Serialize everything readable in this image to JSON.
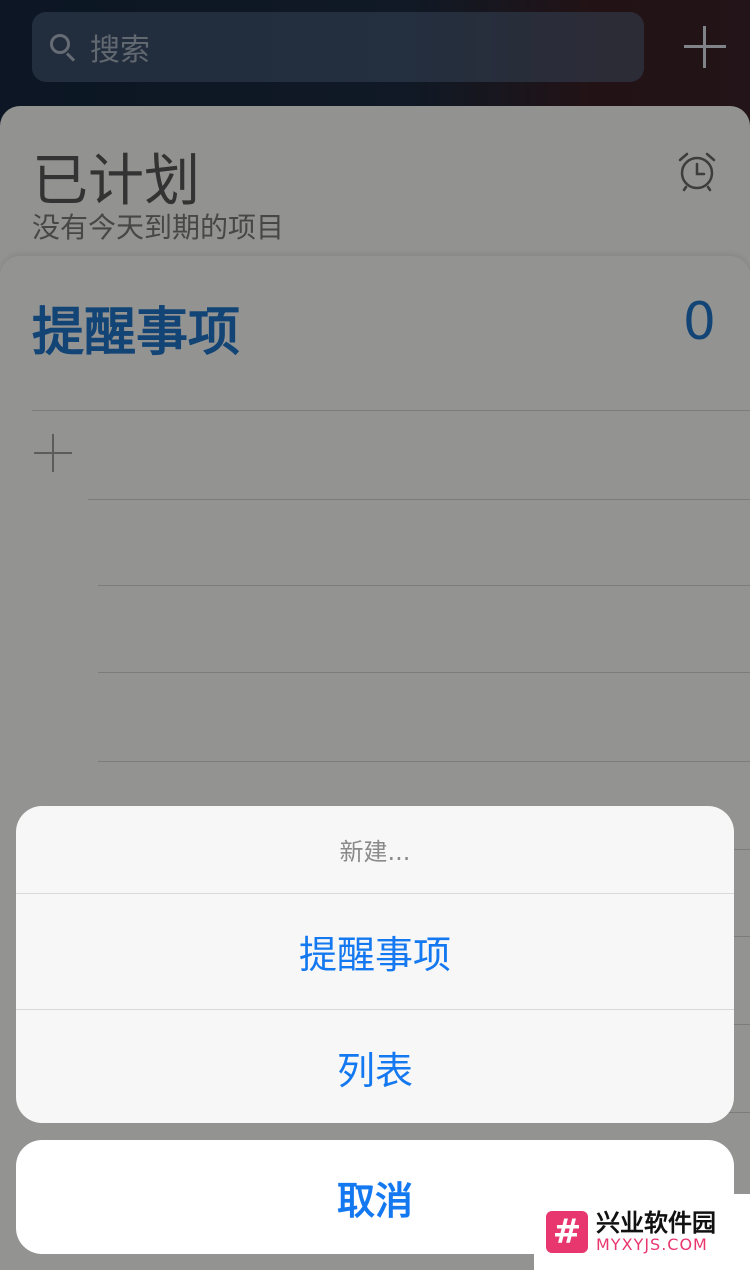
{
  "search": {
    "placeholder": "搜索"
  },
  "scheduled": {
    "title": "已计划",
    "subtitle": "没有今天到期的项目"
  },
  "reminders": {
    "title": "提醒事项",
    "count": "0"
  },
  "action_sheet": {
    "header": "新建...",
    "options": [
      {
        "label": "提醒事项"
      },
      {
        "label": "列表"
      }
    ],
    "cancel_label": "取消"
  },
  "watermark": {
    "logo": "#",
    "title": "兴业软件园",
    "url": "MYXYJS.COM"
  },
  "colors": {
    "accent": "#1479f0",
    "list_title": "#1f72c4",
    "watermark": "#e8366f"
  },
  "icons": [
    "search-icon",
    "add-icon",
    "alarm-clock-icon",
    "plus-icon"
  ]
}
